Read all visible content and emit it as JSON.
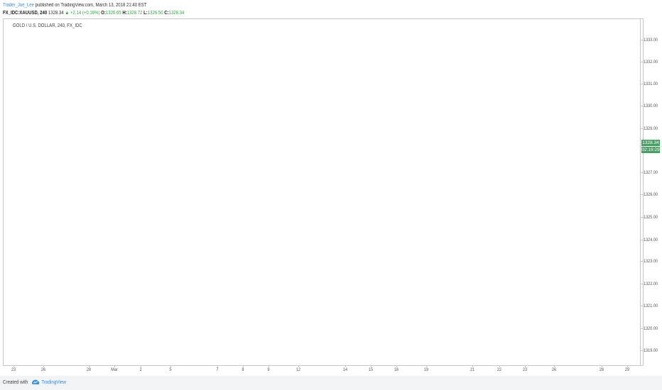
{
  "header": {
    "author": "Trader_Joe_Lee",
    "published_text": "published on TradingView.com, March 13, 2018 21:40 EST",
    "symbol": "FX_IDC:XAUUSD, 240",
    "last_price": "1328.34",
    "change": "▲ +2.14 (+0.16%)",
    "open_label": "O:",
    "open_value": "1326.65",
    "high_label": "H:",
    "high_value": "1328.72",
    "low_label": "L:",
    "low_value": "1326.50",
    "close_label": "C:",
    "close_value": "1328.34"
  },
  "legend": "GOLD / U.S. DOLLAR, 240, FX_IDC",
  "price_axis": {
    "ticks": [
      "1333.00",
      "1332.00",
      "1331.00",
      "1330.00",
      "1329.00",
      "1327.00",
      "1326.00",
      "1325.00",
      "1324.00",
      "1323.00",
      "1322.00",
      "1321.00",
      "1320.00",
      "1319.00"
    ],
    "current_price_tag": "1328.34",
    "countdown_tag": "02:19:29",
    "tag_color": "#4a9d65"
  },
  "time_axis": {
    "ticks": [
      "23",
      "26",
      "28",
      "Mar",
      "2",
      "5",
      "7",
      "8",
      "9",
      "12",
      "14",
      "15",
      "16",
      "19",
      "21",
      "22",
      "23",
      "26",
      "28",
      "29"
    ]
  },
  "footer": {
    "created_with": "Created with",
    "brand": "TradingView",
    "brand_icon": "tradingview-cloud-icon"
  },
  "colors": {
    "link": "#3c8ed1",
    "up": "#38a34a",
    "axis": "#c7c7c7"
  }
}
